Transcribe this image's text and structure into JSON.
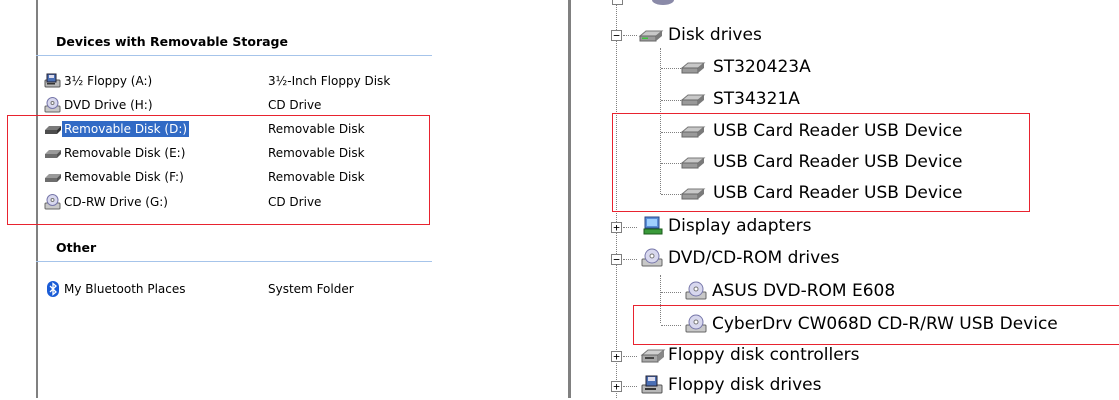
{
  "left_panel": {
    "groups": [
      {
        "header": "Devices with Removable Storage",
        "items": [
          {
            "name": "3½ Floppy (A:)",
            "type": "3½-Inch Floppy Disk",
            "icon": "floppy-drive-icon"
          },
          {
            "name": "DVD Drive (H:)",
            "type": "CD Drive",
            "icon": "dvd-drive-icon"
          },
          {
            "name": "Removable Disk (D:)",
            "type": "Removable Disk",
            "icon": "removable-disk-icon",
            "selected": true
          },
          {
            "name": "Removable Disk (E:)",
            "type": "Removable Disk",
            "icon": "removable-disk-icon"
          },
          {
            "name": "Removable Disk (F:)",
            "type": "Removable Disk",
            "icon": "removable-disk-icon"
          },
          {
            "name": "CD-RW Drive (G:)",
            "type": "CD Drive",
            "icon": "cd-drive-icon"
          }
        ]
      },
      {
        "header": "Other",
        "items": [
          {
            "name": "My Bluetooth Places",
            "type": "System Folder",
            "icon": "bluetooth-icon"
          }
        ]
      }
    ]
  },
  "right_panel": {
    "categories": [
      {
        "label": "Disk drives",
        "expanded": true,
        "icon": "disk-drive-icon",
        "children": [
          "ST320423A",
          "ST34321A",
          "USB Card Reader USB Device",
          "USB Card Reader USB Device",
          "USB Card Reader USB Device"
        ]
      },
      {
        "label": "Display adapters",
        "expanded": false,
        "icon": "display-adapter-icon",
        "children": []
      },
      {
        "label": "DVD/CD-ROM drives",
        "expanded": true,
        "icon": "cd-drive-icon",
        "children": [
          "ASUS DVD-ROM E608",
          "CyberDrv CW068D CD-R/RW USB Device"
        ]
      },
      {
        "label": "Floppy disk controllers",
        "expanded": false,
        "icon": "floppy-controller-icon",
        "children": []
      },
      {
        "label": "Floppy disk drives",
        "expanded": false,
        "icon": "floppy-drive-icon",
        "children": []
      }
    ],
    "expand_symbol": "+",
    "collapse_symbol": "−"
  },
  "colors": {
    "highlight_box": "#e8232f",
    "selection": "#316ac5",
    "group_rule": "#a6c4ea"
  }
}
